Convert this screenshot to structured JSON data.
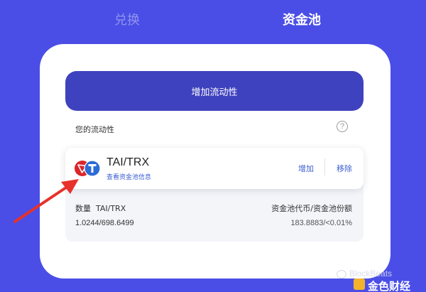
{
  "tabs": {
    "exchange": "兑换",
    "pool": "资金池"
  },
  "card": {
    "add_liquidity_button": "增加流动性",
    "your_liquidity_label": "您的流动性",
    "help_icon_glyph": "?"
  },
  "position": {
    "pair": "TAI/TRX",
    "view_pool_info": "查看资金池信息",
    "add": "增加",
    "remove": "移除",
    "amount_label": "数量",
    "amount_pair": "TAI/TRX",
    "amount_value": "1.0244/698.6499",
    "share_label": "资金池代币/资金池份额",
    "share_value": "183.8883/<0.01%"
  },
  "watermark": {
    "text_top": "BlockBeats",
    "text_bottom": "金色财经"
  },
  "colors": {
    "background": "#4a4ee6",
    "primary_button": "#3f42be",
    "link": "#3b5fd0",
    "annotation_arrow": "#e8312a",
    "token_trx": "#d9262b",
    "token_tai": "#2a6bd8"
  },
  "icons": {
    "token_pair": "tai-trx-token-icon",
    "help": "question-circle-icon",
    "annotation": "red-arrow-icon",
    "watermark_chat": "wechat-icon",
    "watermark_logo": "jinse-logo-icon"
  }
}
